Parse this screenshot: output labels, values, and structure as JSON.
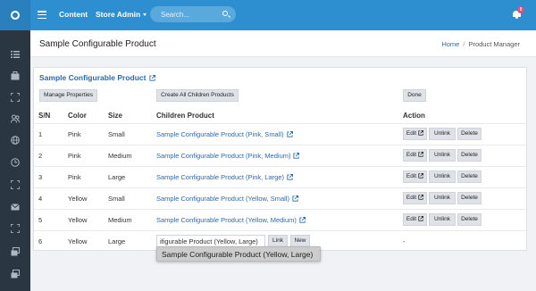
{
  "topbar": {
    "nav_content": "Content",
    "nav_store_admin": "Store Admin",
    "search_placeholder": "Search...",
    "notification_count": "8"
  },
  "colors": {
    "topbar": "#2d8fd0",
    "sidebar": "#2b3643",
    "link": "#2b6aa8"
  },
  "sidebar": {
    "icons": [
      "list-icon",
      "briefcase-icon",
      "expand-icon",
      "users-icon",
      "globe-icon",
      "clock-icon",
      "expand-icon",
      "mail-icon",
      "expand-icon",
      "layers-icon",
      "layers-icon"
    ]
  },
  "header": {
    "title": "Sample Configurable Product",
    "breadcrumb_home": "Home",
    "breadcrumb_current": "Product Manager"
  },
  "card": {
    "title": "Sample Configurable Product",
    "manage_properties": "Manage Properties",
    "create_children": "Create All Children Products",
    "done": "Done"
  },
  "table": {
    "headers": {
      "sn": "S/N",
      "color": "Color",
      "size": "Size",
      "child": "Children Product",
      "action": "Action"
    },
    "rows": [
      {
        "sn": "1",
        "color": "Pink",
        "size": "Small",
        "child": "Sample Configurable Product (Pink, Small)"
      },
      {
        "sn": "2",
        "color": "Pink",
        "size": "Medium",
        "child": "Sample Configurable Product (Pink, Medium)"
      },
      {
        "sn": "3",
        "color": "Pink",
        "size": "Large",
        "child": "Sample Configurable Product (Pink, Large)"
      },
      {
        "sn": "4",
        "color": "Yellow",
        "size": "Small",
        "child": "Sample Configurable Product (Yellow, Small)"
      },
      {
        "sn": "5",
        "color": "Yellow",
        "size": "Medium",
        "child": "Sample Configurable Product (Yellow, Medium)"
      },
      {
        "sn": "6",
        "color": "Yellow",
        "size": "Large",
        "input_value": "ifigurable Product (Yellow, Large)",
        "action": "-"
      }
    ],
    "actions": {
      "edit": "Edit",
      "unlink": "Unlink",
      "delete": "Delete",
      "link": "Link",
      "new": "New"
    }
  },
  "autocomplete": {
    "option": "Sample Configurable Product (Yellow, Large)"
  }
}
